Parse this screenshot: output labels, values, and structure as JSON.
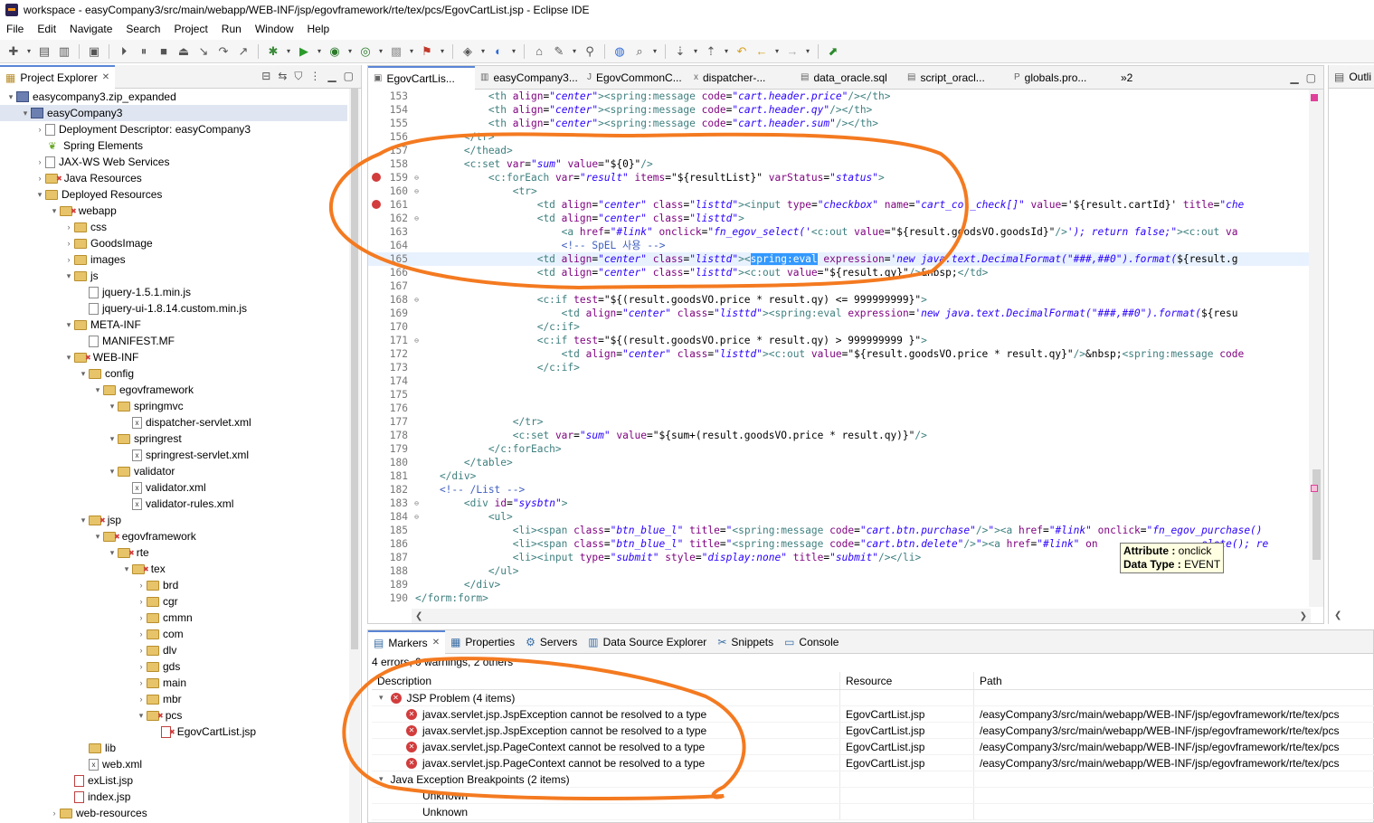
{
  "window": {
    "title": "workspace - easyCompany3/src/main/webapp/WEB-INF/jsp/egovframework/rte/tex/pcs/EgovCartList.jsp - Eclipse IDE"
  },
  "menu": [
    "File",
    "Edit",
    "Navigate",
    "Search",
    "Project",
    "Run",
    "Window",
    "Help"
  ],
  "explorer": {
    "tab_label": "Project Explorer",
    "tree": [
      {
        "label": "easycompany3.zip_expanded",
        "indent": 0,
        "tw": "▾",
        "icon": "proj"
      },
      {
        "label": "easyCompany3",
        "indent": 1,
        "tw": "▾",
        "icon": "proj",
        "selected": true
      },
      {
        "label": "Deployment Descriptor: easyCompany3",
        "indent": 2,
        "tw": "›",
        "icon": "file"
      },
      {
        "label": "Spring Elements",
        "indent": 2,
        "tw": "",
        "icon": "leaf"
      },
      {
        "label": "JAX-WS Web Services",
        "indent": 2,
        "tw": "›",
        "icon": "file"
      },
      {
        "label": "Java Resources",
        "indent": 2,
        "tw": "›",
        "icon": "folder",
        "err": true
      },
      {
        "label": "Deployed Resources",
        "indent": 2,
        "tw": "▾",
        "icon": "folder"
      },
      {
        "label": "webapp",
        "indent": 3,
        "tw": "▾",
        "icon": "folder",
        "err": true
      },
      {
        "label": "css",
        "indent": 4,
        "tw": "›",
        "icon": "folder"
      },
      {
        "label": "GoodsImage",
        "indent": 4,
        "tw": "›",
        "icon": "folder"
      },
      {
        "label": "images",
        "indent": 4,
        "tw": "›",
        "icon": "folder"
      },
      {
        "label": "js",
        "indent": 4,
        "tw": "▾",
        "icon": "folder"
      },
      {
        "label": "jquery-1.5.1.min.js",
        "indent": 5,
        "tw": "",
        "icon": "file"
      },
      {
        "label": "jquery-ui-1.8.14.custom.min.js",
        "indent": 5,
        "tw": "",
        "icon": "file"
      },
      {
        "label": "META-INF",
        "indent": 4,
        "tw": "▾",
        "icon": "folder"
      },
      {
        "label": "MANIFEST.MF",
        "indent": 5,
        "tw": "",
        "icon": "file"
      },
      {
        "label": "WEB-INF",
        "indent": 4,
        "tw": "▾",
        "icon": "folder",
        "err": true
      },
      {
        "label": "config",
        "indent": 5,
        "tw": "▾",
        "icon": "folder"
      },
      {
        "label": "egovframework",
        "indent": 6,
        "tw": "▾",
        "icon": "folder"
      },
      {
        "label": "springmvc",
        "indent": 7,
        "tw": "▾",
        "icon": "folder"
      },
      {
        "label": "dispatcher-servlet.xml",
        "indent": 8,
        "tw": "",
        "icon": "xml"
      },
      {
        "label": "springrest",
        "indent": 7,
        "tw": "▾",
        "icon": "folder"
      },
      {
        "label": "springrest-servlet.xml",
        "indent": 8,
        "tw": "",
        "icon": "xml"
      },
      {
        "label": "validator",
        "indent": 7,
        "tw": "▾",
        "icon": "folder"
      },
      {
        "label": "validator.xml",
        "indent": 8,
        "tw": "",
        "icon": "xml"
      },
      {
        "label": "validator-rules.xml",
        "indent": 8,
        "tw": "",
        "icon": "xml"
      },
      {
        "label": "jsp",
        "indent": 5,
        "tw": "▾",
        "icon": "folder",
        "err": true
      },
      {
        "label": "egovframework",
        "indent": 6,
        "tw": "▾",
        "icon": "folder",
        "err": true
      },
      {
        "label": "rte",
        "indent": 7,
        "tw": "▾",
        "icon": "folder",
        "err": true
      },
      {
        "label": "tex",
        "indent": 8,
        "tw": "▾",
        "icon": "folder",
        "err": true
      },
      {
        "label": "brd",
        "indent": 9,
        "tw": "›",
        "icon": "folder"
      },
      {
        "label": "cgr",
        "indent": 9,
        "tw": "›",
        "icon": "folder"
      },
      {
        "label": "cmmn",
        "indent": 9,
        "tw": "›",
        "icon": "folder"
      },
      {
        "label": "com",
        "indent": 9,
        "tw": "›",
        "icon": "folder"
      },
      {
        "label": "dlv",
        "indent": 9,
        "tw": "›",
        "icon": "folder"
      },
      {
        "label": "gds",
        "indent": 9,
        "tw": "›",
        "icon": "folder"
      },
      {
        "label": "main",
        "indent": 9,
        "tw": "›",
        "icon": "folder"
      },
      {
        "label": "mbr",
        "indent": 9,
        "tw": "›",
        "icon": "folder"
      },
      {
        "label": "pcs",
        "indent": 9,
        "tw": "▾",
        "icon": "folder",
        "err": true
      },
      {
        "label": "EgovCartList.jsp",
        "indent": 10,
        "tw": "",
        "icon": "jsp",
        "err": true
      },
      {
        "label": "lib",
        "indent": 5,
        "tw": "",
        "icon": "folder"
      },
      {
        "label": "web.xml",
        "indent": 5,
        "tw": "",
        "icon": "xml"
      },
      {
        "label": "exList.jsp",
        "indent": 4,
        "tw": "",
        "icon": "jsp"
      },
      {
        "label": "index.jsp",
        "indent": 4,
        "tw": "",
        "icon": "jsp"
      },
      {
        "label": "web-resources",
        "indent": 3,
        "tw": "›",
        "icon": "folder"
      }
    ]
  },
  "editor": {
    "tabs": [
      "EgovCartLis...",
      "easyCompany3...",
      "EgovCommonC...",
      "dispatcher-...",
      "data_oracle.sql",
      "script_oracl...",
      "globals.pro...",
      "»2"
    ],
    "lines": [
      {
        "n": "153",
        "html": "<span class=\"t-tag\">            &lt;th</span> <span class=\"t-attr\">align</span>=<span class=\"t-val\">\"center\"</span><span class=\"t-tag\">&gt;&lt;spring:message</span> <span class=\"t-attr\">code</span>=<span class=\"t-val\">\"cart.header.price\"</span><span class=\"t-tag\">/&gt;&lt;/th&gt;</span>"
      },
      {
        "n": "154",
        "html": "<span class=\"t-tag\">            &lt;th</span> <span class=\"t-attr\">align</span>=<span class=\"t-val\">\"center\"</span><span class=\"t-tag\">&gt;&lt;spring:message</span> <span class=\"t-attr\">code</span>=<span class=\"t-val\">\"cart.header.qy\"</span><span class=\"t-tag\">/&gt;&lt;/th&gt;</span>"
      },
      {
        "n": "155",
        "html": "<span class=\"t-tag\">            &lt;th</span> <span class=\"t-attr\">align</span>=<span class=\"t-val\">\"center\"</span><span class=\"t-tag\">&gt;&lt;spring:message</span> <span class=\"t-attr\">code</span>=<span class=\"t-val\">\"cart.header.sum\"</span><span class=\"t-tag\">/&gt;&lt;/th&gt;</span>"
      },
      {
        "n": "156",
        "html": "<span class=\"t-tag\">        &lt;/tr&gt;</span>"
      },
      {
        "n": "157",
        "html": "<span class=\"t-tag\">        &lt;/thead&gt;</span>"
      },
      {
        "n": "158",
        "html": "<span class=\"t-tag\">        &lt;c:set</span> <span class=\"t-attr\">var</span>=<span class=\"t-val\">\"sum\"</span> <span class=\"t-attr\">value</span>=\"${0}\"<span class=\"t-tag\">/&gt;</span>"
      },
      {
        "n": "159",
        "err": true,
        "fold": true,
        "html": "<span class=\"t-tag\">            &lt;c:forEach</span> <span class=\"t-attr\">var</span>=<span class=\"t-val\">\"result\"</span> <span class=\"t-attr\">items</span>=\"${resultList}\" <span class=\"t-attr\">varStatus</span>=<span class=\"t-val\">\"status\"</span><span class=\"t-tag\">&gt;</span>"
      },
      {
        "n": "160",
        "fold": true,
        "html": "<span class=\"t-tag\">                &lt;tr&gt;</span>"
      },
      {
        "n": "161",
        "err": true,
        "html": "<span class=\"t-tag\">                    &lt;td</span> <span class=\"t-attr\">align</span>=<span class=\"t-val\">\"center\"</span> <span class=\"t-attr\">class</span>=<span class=\"t-val\">\"listtd\"</span><span class=\"t-tag\">&gt;&lt;input</span> <span class=\"t-attr\">type</span>=<span class=\"t-val\">\"checkbox\"</span> <span class=\"t-attr\">name</span>=<span class=\"t-val\">\"cart_col_check[]\"</span> <span class=\"t-attr\">value</span>='${result.cartId}' <span class=\"t-attr\">title</span>=<span class=\"t-val\">\"che</span>"
      },
      {
        "n": "162",
        "fold": true,
        "html": "<span class=\"t-tag\">                    &lt;td</span> <span class=\"t-attr\">align</span>=<span class=\"t-val\">\"center\"</span> <span class=\"t-attr\">class</span>=<span class=\"t-val\">\"listtd\"</span><span class=\"t-tag\">&gt;</span>"
      },
      {
        "n": "163",
        "html": "<span class=\"t-tag\">                        &lt;a</span> <span class=\"t-attr\">href</span>=<span class=\"t-val\">\"#link\"</span> <span class=\"t-attr\">onclick</span>=<span class=\"t-val\">\"fn_egov_select('</span><span class=\"t-tag\">&lt;c:out</span> <span class=\"t-attr\">value</span>=\"${result.goodsVO.goodsId}\"<span class=\"t-tag\">/&gt;</span><span class=\"t-val\">'); return false;\"</span><span class=\"t-tag\">&gt;&lt;c:out</span> <span class=\"t-attr\">va</span>"
      },
      {
        "n": "164",
        "html": "<span class=\"t-cm\">                        &lt;!-- SpEL 사용 --&gt;</span>"
      },
      {
        "n": "165",
        "hl": true,
        "html": "<span class=\"t-tag\">                    &lt;td</span> <span class=\"t-attr\">align</span>=<span class=\"t-val\">\"center\"</span> <span class=\"t-attr\">class</span>=<span class=\"t-val\">\"listtd\"</span><span class=\"t-tag\">&gt;&lt;</span><span class=\"t-sel\">spring:eval</span> <span class=\"t-attr\">expression</span>=<span class=\"t-val\">'new java.text.DecimalFormat(\"###,##0\").format(</span>${result.g</span>"
      },
      {
        "n": "166",
        "html": "<span class=\"t-tag\">                    &lt;td</span> <span class=\"t-attr\">align</span>=<span class=\"t-val\">\"center\"</span> <span class=\"t-attr\">class</span>=<span class=\"t-val\">\"listtd\"</span><span class=\"t-tag\">&gt;&lt;c:out</span> <span class=\"t-attr\">value</span>=\"${result.qy}\"<span class=\"t-tag\">/&gt;</span>&amp;nbsp;<span class=\"t-tag\">&lt;/td&gt;</span>"
      },
      {
        "n": "167",
        "html": ""
      },
      {
        "n": "168",
        "fold": true,
        "html": "<span class=\"t-tag\">                    &lt;c:if</span> <span class=\"t-attr\">test</span>=\"${(result.goodsVO.price * result.qy) &lt;= 999999999}\"<span class=\"t-tag\">&gt;</span>"
      },
      {
        "n": "169",
        "html": "<span class=\"t-tag\">                        &lt;td</span> <span class=\"t-attr\">align</span>=<span class=\"t-val\">\"center\"</span> <span class=\"t-attr\">class</span>=<span class=\"t-val\">\"listtd\"</span><span class=\"t-tag\">&gt;&lt;spring:eval</span> <span class=\"t-attr\">expression</span>=<span class=\"t-val\">'new java.text.DecimalFormat(\"###,##0\").format(</span>${resu</span>"
      },
      {
        "n": "170",
        "html": "<span class=\"t-tag\">                    &lt;/c:if&gt;</span>"
      },
      {
        "n": "171",
        "fold": true,
        "html": "<span class=\"t-tag\">                    &lt;c:if</span> <span class=\"t-attr\">test</span>=\"${(result.goodsVO.price * result.qy) &gt; 999999999 }\"<span class=\"t-tag\">&gt;</span>"
      },
      {
        "n": "172",
        "html": "<span class=\"t-tag\">                        &lt;td</span> <span class=\"t-attr\">align</span>=<span class=\"t-val\">\"center\"</span> <span class=\"t-attr\">class</span>=<span class=\"t-val\">\"listtd\"</span><span class=\"t-tag\">&gt;&lt;c:out</span> <span class=\"t-attr\">value</span>=\"${result.goodsVO.price * result.qy}\"<span class=\"t-tag\">/&gt;</span>&amp;nbsp;<span class=\"t-tag\">&lt;spring:message</span> <span class=\"t-attr\">code</span>"
      },
      {
        "n": "173",
        "html": "<span class=\"t-tag\">                    &lt;/c:if&gt;</span>"
      },
      {
        "n": "174",
        "html": ""
      },
      {
        "n": "175",
        "html": ""
      },
      {
        "n": "176",
        "html": ""
      },
      {
        "n": "177",
        "html": "<span class=\"t-tag\">                &lt;/tr&gt;</span>"
      },
      {
        "n": "178",
        "html": "<span class=\"t-tag\">                &lt;c:set</span> <span class=\"t-attr\">var</span>=<span class=\"t-val\">\"sum\"</span> <span class=\"t-attr\">value</span>=\"${sum+(result.goodsVO.price * result.qy)}\"<span class=\"t-tag\">/&gt;</span>"
      },
      {
        "n": "179",
        "html": "<span class=\"t-tag\">            &lt;/c:forEach&gt;</span>"
      },
      {
        "n": "180",
        "html": "<span class=\"t-tag\">        &lt;/table&gt;</span>"
      },
      {
        "n": "181",
        "html": "<span class=\"t-tag\">    &lt;/div&gt;</span>"
      },
      {
        "n": "182",
        "html": "<span class=\"t-cm\">    &lt;!-- /List --&gt;</span>"
      },
      {
        "n": "183",
        "fold": true,
        "html": "<span class=\"t-tag\">        &lt;div</span> <span class=\"t-attr\">id</span>=<span class=\"t-val\">\"sysbtn\"</span><span class=\"t-tag\">&gt;</span>"
      },
      {
        "n": "184",
        "fold": true,
        "html": "<span class=\"t-tag\">            &lt;ul&gt;</span>"
      },
      {
        "n": "185",
        "html": "<span class=\"t-tag\">                &lt;li&gt;&lt;span</span> <span class=\"t-attr\">class</span>=<span class=\"t-val\">\"btn_blue_l\"</span> <span class=\"t-attr\">title</span>=<span class=\"t-val\">\"</span><span class=\"t-tag\">&lt;spring:message</span> <span class=\"t-attr\">code</span>=<span class=\"t-val\">\"cart.btn.purchase\"</span><span class=\"t-tag\">/&gt;</span><span class=\"t-val\">\"</span><span class=\"t-tag\">&gt;&lt;a</span> <span class=\"t-attr\">href</span>=<span class=\"t-val\">\"#link\"</span> <span class=\"t-attr\">onclick</span>=<span class=\"t-val\">\"fn_egov_purchase()</span>"
      },
      {
        "n": "186",
        "html": "<span class=\"t-tag\">                &lt;li&gt;&lt;span</span> <span class=\"t-attr\">class</span>=<span class=\"t-val\">\"btn_blue_l\"</span> <span class=\"t-attr\">title</span>=<span class=\"t-val\">\"</span><span class=\"t-tag\">&lt;spring:message</span> <span class=\"t-attr\">code</span>=<span class=\"t-val\">\"cart.btn.delete\"</span><span class=\"t-tag\">/&gt;</span><span class=\"t-val\">\"</span><span class=\"t-tag\">&gt;&lt;a</span> <span class=\"t-attr\">href</span>=<span class=\"t-val\">\"#link\"</span> <span class=\"t-attr\">on</span>                 <span class=\"t-val\">elete(); re</span>"
      },
      {
        "n": "187",
        "html": "<span class=\"t-tag\">                &lt;li&gt;&lt;input</span> <span class=\"t-attr\">type</span>=<span class=\"t-val\">\"submit\"</span> <span class=\"t-attr\">style</span>=<span class=\"t-val\">\"display:none\"</span> <span class=\"t-attr\">title</span>=<span class=\"t-val\">\"submit\"</span><span class=\"t-tag\">/&gt;&lt;/li&gt;</span>"
      },
      {
        "n": "188",
        "html": "<span class=\"t-tag\">            &lt;/ul&gt;</span>"
      },
      {
        "n": "189",
        "html": "<span class=\"t-tag\">        &lt;/div&gt;</span>"
      },
      {
        "n": "190",
        "html": "<span class=\"t-tag\">&lt;/form:form&gt;</span>"
      }
    ]
  },
  "tooltip": {
    "attr_label": "Attribute :",
    "attr_value": "onclick",
    "type_label": "Data Type :",
    "type_value": "EVENT"
  },
  "outline": {
    "tab_label": "Outli"
  },
  "bottom": {
    "tabs": [
      "Markers",
      "Properties",
      "Servers",
      "Data Source Explorer",
      "Snippets",
      "Console"
    ],
    "summary": "4 errors, 0 warnings, 2 others",
    "columns": [
      "Description",
      "Resource",
      "Path"
    ],
    "groups": [
      {
        "label": "JSP Problem (4 items)",
        "error": true,
        "rows": [
          {
            "desc": "javax.servlet.jsp.JspException cannot be resolved to a type",
            "resource": "EgovCartList.jsp",
            "path": "/easyCompany3/src/main/webapp/WEB-INF/jsp/egovframework/rte/tex/pcs"
          },
          {
            "desc": "javax.servlet.jsp.JspException cannot be resolved to a type",
            "resource": "EgovCartList.jsp",
            "path": "/easyCompany3/src/main/webapp/WEB-INF/jsp/egovframework/rte/tex/pcs"
          },
          {
            "desc": "javax.servlet.jsp.PageContext cannot be resolved to a type",
            "resource": "EgovCartList.jsp",
            "path": "/easyCompany3/src/main/webapp/WEB-INF/jsp/egovframework/rte/tex/pcs"
          },
          {
            "desc": "javax.servlet.jsp.PageContext cannot be resolved to a type",
            "resource": "EgovCartList.jsp",
            "path": "/easyCompany3/src/main/webapp/WEB-INF/jsp/egovframework/rte/tex/pcs"
          }
        ]
      },
      {
        "label": "Java Exception Breakpoints (2 items)",
        "error": false,
        "rows": [
          {
            "desc": "Unknown",
            "resource": "",
            "path": ""
          },
          {
            "desc": "Unknown",
            "resource": "",
            "path": ""
          }
        ]
      }
    ]
  },
  "colors": {
    "annotation": "#f47a20",
    "error": "#d23c3c",
    "selection": "#3399ff"
  }
}
